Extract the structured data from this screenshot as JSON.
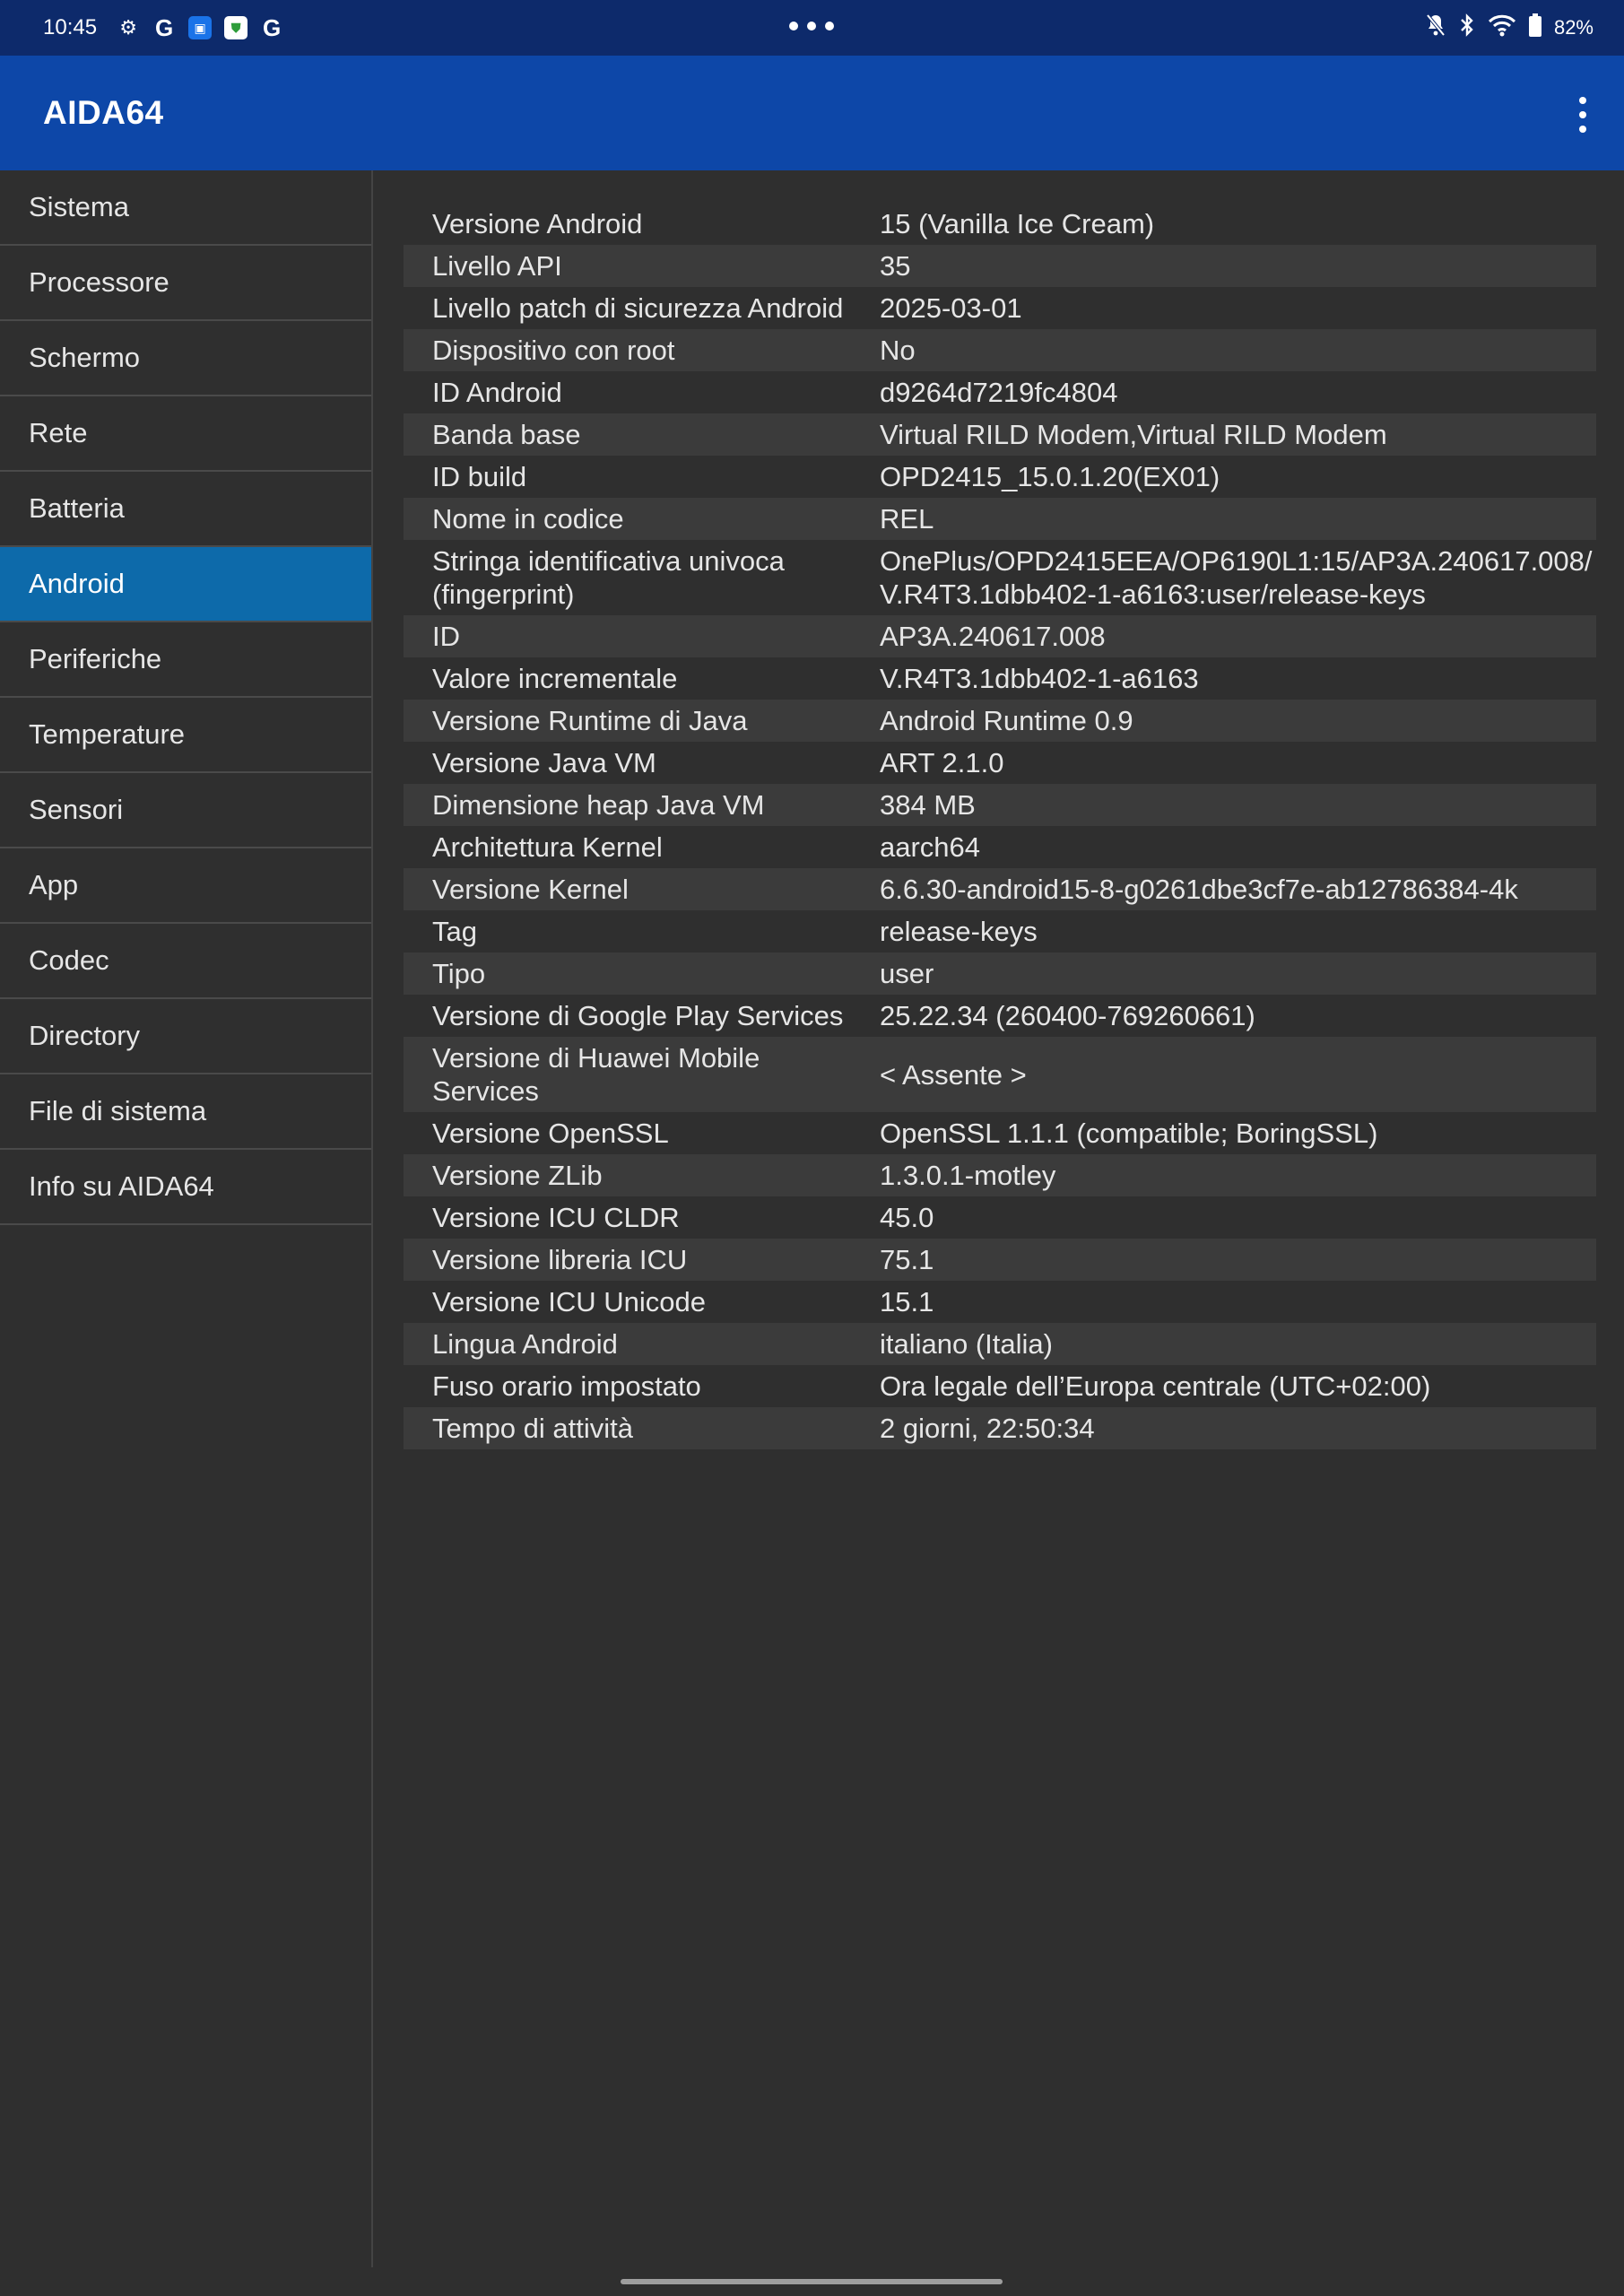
{
  "status_bar": {
    "time": "10:45",
    "battery": "82%",
    "icons_left": [
      "gear-icon",
      "google-icon",
      "outlook-icon",
      "shield-icon",
      "google-icon"
    ],
    "icons_right": [
      "bell-off-icon",
      "bluetooth-icon",
      "wifi-icon",
      "battery-icon"
    ]
  },
  "app_bar": {
    "title": "AIDA64"
  },
  "sidebar": {
    "active": "Android",
    "items": [
      {
        "label": "Sistema"
      },
      {
        "label": "Processore"
      },
      {
        "label": "Schermo"
      },
      {
        "label": "Rete"
      },
      {
        "label": "Batteria"
      },
      {
        "label": "Android"
      },
      {
        "label": "Periferiche"
      },
      {
        "label": "Temperature"
      },
      {
        "label": "Sensori"
      },
      {
        "label": "App"
      },
      {
        "label": "Codec"
      },
      {
        "label": "Directory"
      },
      {
        "label": "File di sistema"
      },
      {
        "label": "Info su AIDA64"
      }
    ]
  },
  "info": {
    "rows": [
      {
        "key": "Versione Android",
        "value": "15 (Vanilla Ice Cream)"
      },
      {
        "key": "Livello API",
        "value": "35"
      },
      {
        "key": "Livello patch di sicurezza Android",
        "value": "2025-03-01"
      },
      {
        "key": "Dispositivo con root",
        "value": "No"
      },
      {
        "key": "ID Android",
        "value": "d9264d7219fc4804"
      },
      {
        "key": "Banda base",
        "value": "Virtual RILD Modem,Virtual RILD Modem"
      },
      {
        "key": "ID build",
        "value": "OPD2415_15.0.1.20(EX01)"
      },
      {
        "key": "Nome in codice",
        "value": "REL"
      },
      {
        "key": "Stringa identificativa univoca (fingerprint)",
        "value": "OnePlus/OPD2415EEA/OP6190L1:15/AP3A.240617.008/V.R4T3.1dbb402-1-a6163:user/release-keys"
      },
      {
        "key": "ID",
        "value": "AP3A.240617.008"
      },
      {
        "key": "Valore incrementale",
        "value": "V.R4T3.1dbb402-1-a6163"
      },
      {
        "key": "Versione Runtime di Java",
        "value": "Android Runtime 0.9"
      },
      {
        "key": "Versione Java VM",
        "value": "ART 2.1.0"
      },
      {
        "key": "Dimensione heap Java VM",
        "value": "384 MB"
      },
      {
        "key": "Architettura Kernel",
        "value": "aarch64"
      },
      {
        "key": "Versione Kernel",
        "value": "6.6.30-android15-8-g0261dbe3cf7e-ab12786384-4k"
      },
      {
        "key": "Tag",
        "value": "release-keys"
      },
      {
        "key": "Tipo",
        "value": "user"
      },
      {
        "key": "Versione di Google Play Services",
        "value": "25.22.34 (260400-769260661)"
      },
      {
        "key": "Versione di Huawei Mobile Services",
        "value": "< Assente >"
      },
      {
        "key": "Versione OpenSSL",
        "value": "OpenSSL 1.1.1 (compatible; BoringSSL)"
      },
      {
        "key": "Versione ZLib",
        "value": "1.3.0.1-motley"
      },
      {
        "key": "Versione ICU CLDR",
        "value": "45.0"
      },
      {
        "key": "Versione libreria ICU",
        "value": "75.1"
      },
      {
        "key": "Versione ICU Unicode",
        "value": "15.1"
      },
      {
        "key": "Lingua Android",
        "value": "italiano (Italia)"
      },
      {
        "key": "Fuso orario impostato",
        "value": "Ora legale dell’Europa centrale (UTC+02:00)"
      },
      {
        "key": "Tempo di attività",
        "value": "2 giorni, 22:50:34"
      }
    ]
  },
  "colors": {
    "status_bar": "#0d2a6b",
    "app_bar": "#0d47a8",
    "active_item": "#0d6aaa",
    "background": "#2f2f2f",
    "stripe": "#3b3b3b"
  }
}
